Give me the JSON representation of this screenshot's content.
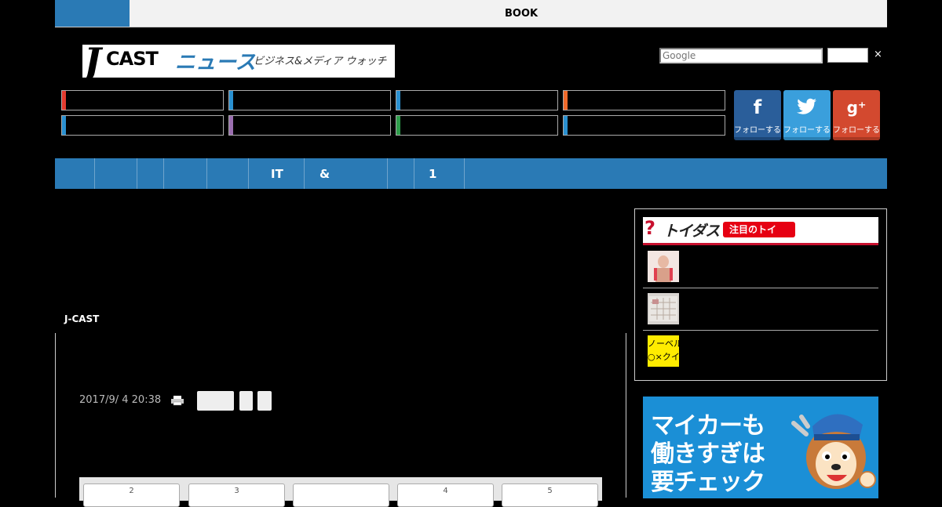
{
  "topbar": {
    "label": "BOOK"
  },
  "logo": {
    "j": "J",
    "cast": "CAST",
    "news": "ニュース",
    "tagline": "ビジネス&メディア ウォッチ"
  },
  "search": {
    "placeholder": "Google",
    "close": "×"
  },
  "categories": {
    "row1_colors": [
      "#e33b2f",
      "#2a90d0",
      "#2a90d0",
      "#f06a2b"
    ],
    "row2_colors": [
      "#2a90d0",
      "#9b6fb0",
      "#2e9d4b",
      "#2a90d0"
    ]
  },
  "social": [
    {
      "name": "facebook",
      "glyph": "f",
      "label": "フォローする",
      "color": "#2a5e9a",
      "shade": "#1c4677"
    },
    {
      "name": "twitter",
      "glyph": "🐦",
      "label": "フォローする",
      "color": "#3a9fdc",
      "shade": "#2a7fb2"
    },
    {
      "name": "google-plus",
      "glyph": "g⁺",
      "label": "フォローする",
      "color": "#d3492f",
      "shade": "#a93822"
    }
  ],
  "nav": {
    "items": [
      "IT",
      "&",
      "1"
    ]
  },
  "article": {
    "source": "J-CAST",
    "date": "2017/9/ 4 20:38"
  },
  "pager": {
    "tabs": [
      "2",
      "3",
      "",
      "4",
      "5"
    ]
  },
  "sidebar": {
    "toigus": {
      "q": "?",
      "title": "トイダス",
      "pill": "注目のトイ"
    },
    "thumb3_text": "ノーベル\n○×クイ"
  },
  "ad": {
    "line1": "マイカーも",
    "line2": "働きすぎは",
    "line3": "要チェック"
  },
  "colors": {
    "accent": "#2a7ab5",
    "toigus_red": "#e60012"
  }
}
